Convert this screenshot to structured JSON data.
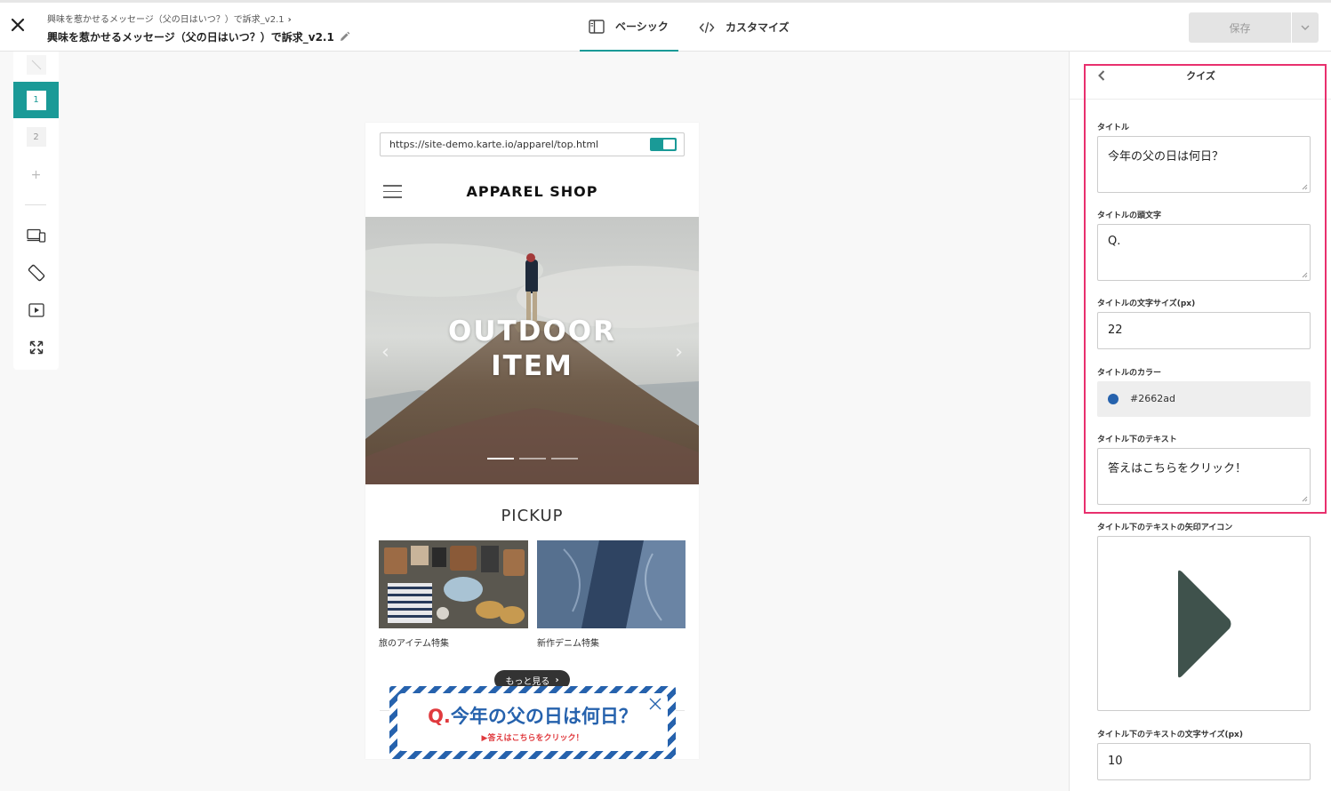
{
  "header": {
    "breadcrumb": "興味を惹かせるメッセージ（父の日はいつ？）で訴求_v2.1",
    "title": "興味を惹かせるメッセージ（父の日はいつ？）で訴求_v2.1",
    "tabs": [
      {
        "label": "ベーシック",
        "active": true
      },
      {
        "label": "カスタマイズ",
        "active": false
      }
    ],
    "save_label": "保存"
  },
  "rail": {
    "steps": [
      "1",
      "2"
    ],
    "add_symbol": "+"
  },
  "preview": {
    "url": "https://site-demo.karte.io/apparel/top.html",
    "shop_name": "APPAREL SHOP",
    "hero_line1": "OUTDOOR",
    "hero_line2": "ITEM",
    "pickup_title": "PICKUP",
    "cards": [
      {
        "label": "旅のアイテム特集"
      },
      {
        "label": "新作デニム特集"
      }
    ],
    "more_label": "もっと見る",
    "quiz_prefix": "Q.",
    "quiz_title": "今年の父の日は何日？",
    "quiz_sub": "答えはこちらをクリック！"
  },
  "panel": {
    "title": "クイズ",
    "fields": {
      "title_label": "タイトル",
      "title_value": "今年の父の日は何日？",
      "prefix_label": "タイトルの頭文字",
      "prefix_value": "Q.",
      "size_label": "タイトルの文字サイズ(px)",
      "size_value": "22",
      "color_label": "タイトルのカラー",
      "color_value": "#2662ad",
      "sub_label": "タイトル下のテキスト",
      "sub_value": "答えはこちらをクリック！",
      "arrow_label": "タイトル下のテキストの矢印アイコン",
      "sub_size_label": "タイトル下のテキストの文字サイズ(px)",
      "sub_size_value": "10"
    }
  },
  "colors": {
    "accent": "#1a9a97",
    "quiz_title": "#2662ad",
    "quiz_highlight": "#e03a3e",
    "selection_outline": "#e8306e",
    "arrow_icon": "#3f524c"
  }
}
